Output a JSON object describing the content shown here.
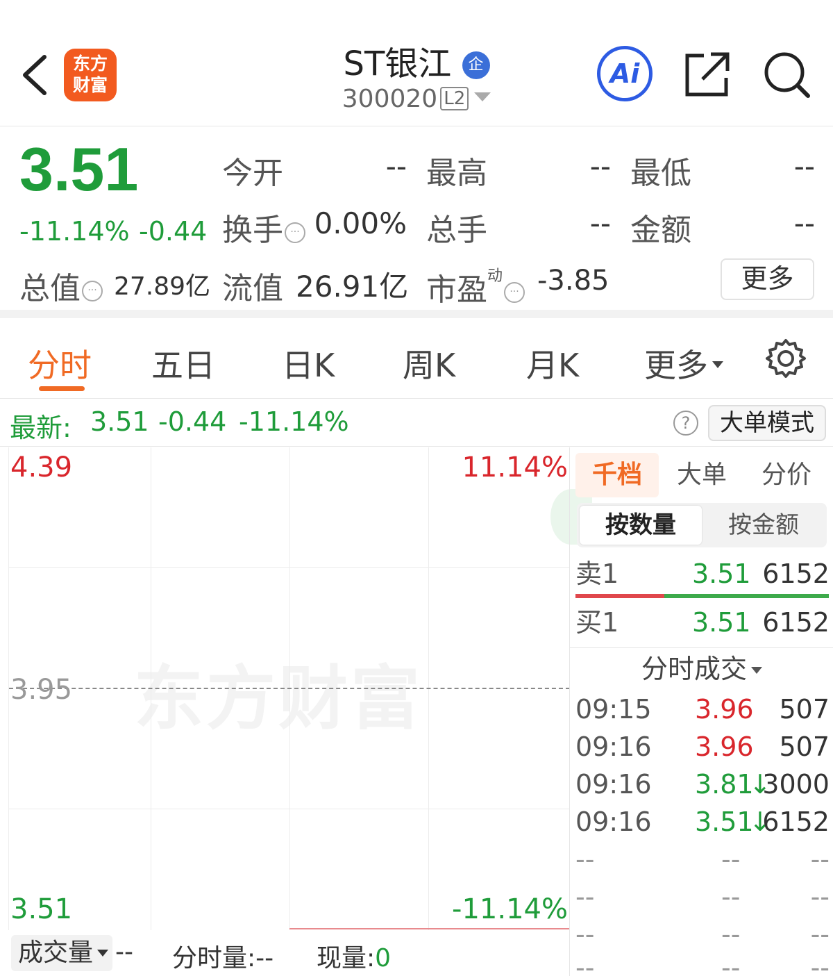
{
  "header": {
    "back_icon": "chevron-left-icon",
    "logo_line1": "东方",
    "logo_line2": "财富",
    "stock_name": "ST银江",
    "badge": "企",
    "stock_code": "300020",
    "level": "L2",
    "ai_label": "Ai",
    "share_icon": "share-icon",
    "search_icon": "search-icon"
  },
  "quote": {
    "price": "3.51",
    "change_pct": "-11.14%",
    "change": "-0.44",
    "open_label": "今开",
    "open_value": "--",
    "high_label": "最高",
    "high_value": "--",
    "low_label": "最低",
    "low_value": "--",
    "turnover_label": "换手",
    "turnover_value": "0.00%",
    "volume_label": "总手",
    "volume_value": "--",
    "amount_label": "金额",
    "amount_value": "--",
    "mktcap_label": "总值",
    "mktcap_value": "27.89亿",
    "float_label": "流值",
    "float_value": "26.91亿",
    "pe_label": "市盈",
    "pe_sup": "动",
    "pe_value": "-3.85",
    "more_button": "更多",
    "colors": {
      "down": "#1f9c3a",
      "up": "#d9262c",
      "accent": "#f06a24"
    }
  },
  "tabs": [
    "分时",
    "五日",
    "日K",
    "周K",
    "月K",
    "更多"
  ],
  "latest": {
    "label": "最新:",
    "price": "3.51",
    "change": "-0.44",
    "change_pct": "-11.14%",
    "mode_button": "大单模式"
  },
  "chart": {
    "top_price": "4.39",
    "top_pct": "11.14%",
    "mid_price": "3.95",
    "bottom_price": "3.51",
    "bottom_pct": "-11.14%",
    "watermark": "东方财富"
  },
  "volume_bar": {
    "selector": "成交量",
    "selector_value": "--",
    "minute_vol": "分时量:--",
    "current_vol_label": "现量:",
    "current_vol_value": "0"
  },
  "right_panel": {
    "tabs": [
      "千档",
      "大单",
      "分价"
    ],
    "segments": [
      "按数量",
      "按金额"
    ],
    "orderbook": [
      {
        "label": "卖1",
        "price": "3.51",
        "qty": "6152"
      },
      {
        "label": "买1",
        "price": "3.51",
        "qty": "6152"
      }
    ],
    "trades_header": "分时成交",
    "trades": [
      {
        "time": "09:15",
        "price": "3.96",
        "qty": "507",
        "dir": ""
      },
      {
        "time": "09:16",
        "price": "3.96",
        "qty": "507",
        "dir": ""
      },
      {
        "time": "09:16",
        "price": "3.81",
        "qty": "3000",
        "dir": "↓"
      },
      {
        "time": "09:16",
        "price": "3.51",
        "qty": "6152",
        "dir": "↓"
      },
      {
        "time": "--",
        "price": "--",
        "qty": "--",
        "dir": ""
      },
      {
        "time": "--",
        "price": "--",
        "qty": "--",
        "dir": ""
      },
      {
        "time": "--",
        "price": "--",
        "qty": "--",
        "dir": ""
      },
      {
        "time": "--",
        "price": "--",
        "qty": "--",
        "dir": ""
      }
    ]
  }
}
